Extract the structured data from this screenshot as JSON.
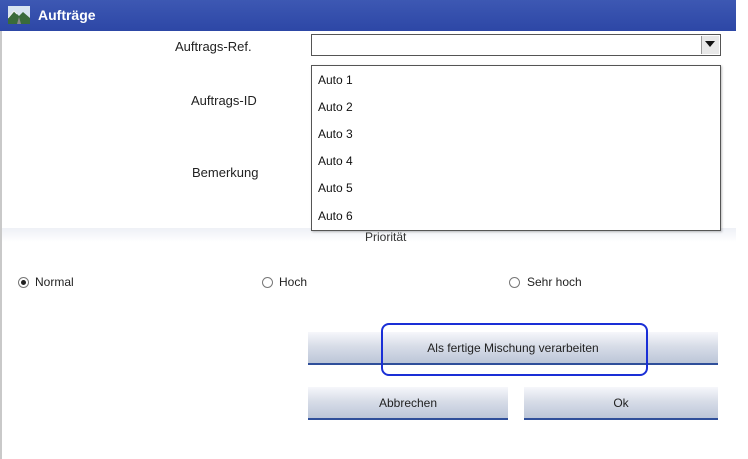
{
  "window": {
    "title": "Aufträge",
    "icon": "mountain-road-icon"
  },
  "form": {
    "ref_label": "Auftrags-Ref.",
    "ref_value": "",
    "id_label": "Auftrags-ID",
    "remark_label": "Bemerkung",
    "priority_label": "Priorität"
  },
  "dropdown": {
    "options": [
      "Auto 1",
      "Auto 2",
      "Auto 3",
      "Auto 4",
      "Auto 5",
      "Auto 6"
    ]
  },
  "priority": {
    "options": [
      "Normal",
      "Hoch",
      "Sehr hoch"
    ],
    "selected": "Normal"
  },
  "buttons": {
    "process": "Als fertige Mischung verarbeiten",
    "cancel": "Abbrechen",
    "ok": "Ok"
  },
  "colors": {
    "titlebar": "#2d47a6",
    "highlight": "#1a2fd6",
    "button_accent": "#2f4f9a"
  }
}
